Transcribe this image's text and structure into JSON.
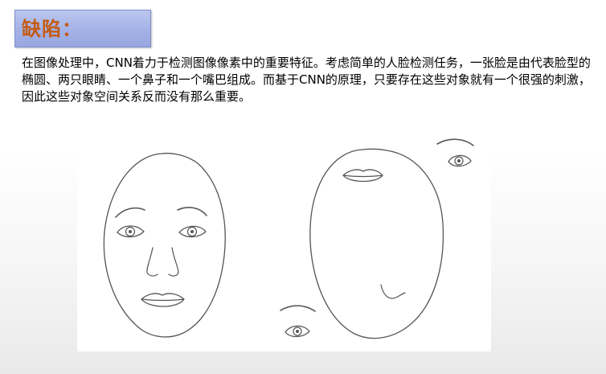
{
  "title": "缺陷：",
  "paragraph": "在图像处理中，CNN着力于检测图像像素中的重要特征。考虑简单的人脸检测任务，一张脸是由代表脸型的椭圆、两只眼睛、一个鼻子和一个嘴巴组成。而基于CNN的原理，只要存在这些对象就有一个很强的刺激，因此这些对象空间关系反而没有那么重要。",
  "figure": {
    "left_face": "normal-face-sketch",
    "right_face": "scrambled-face-sketch"
  }
}
